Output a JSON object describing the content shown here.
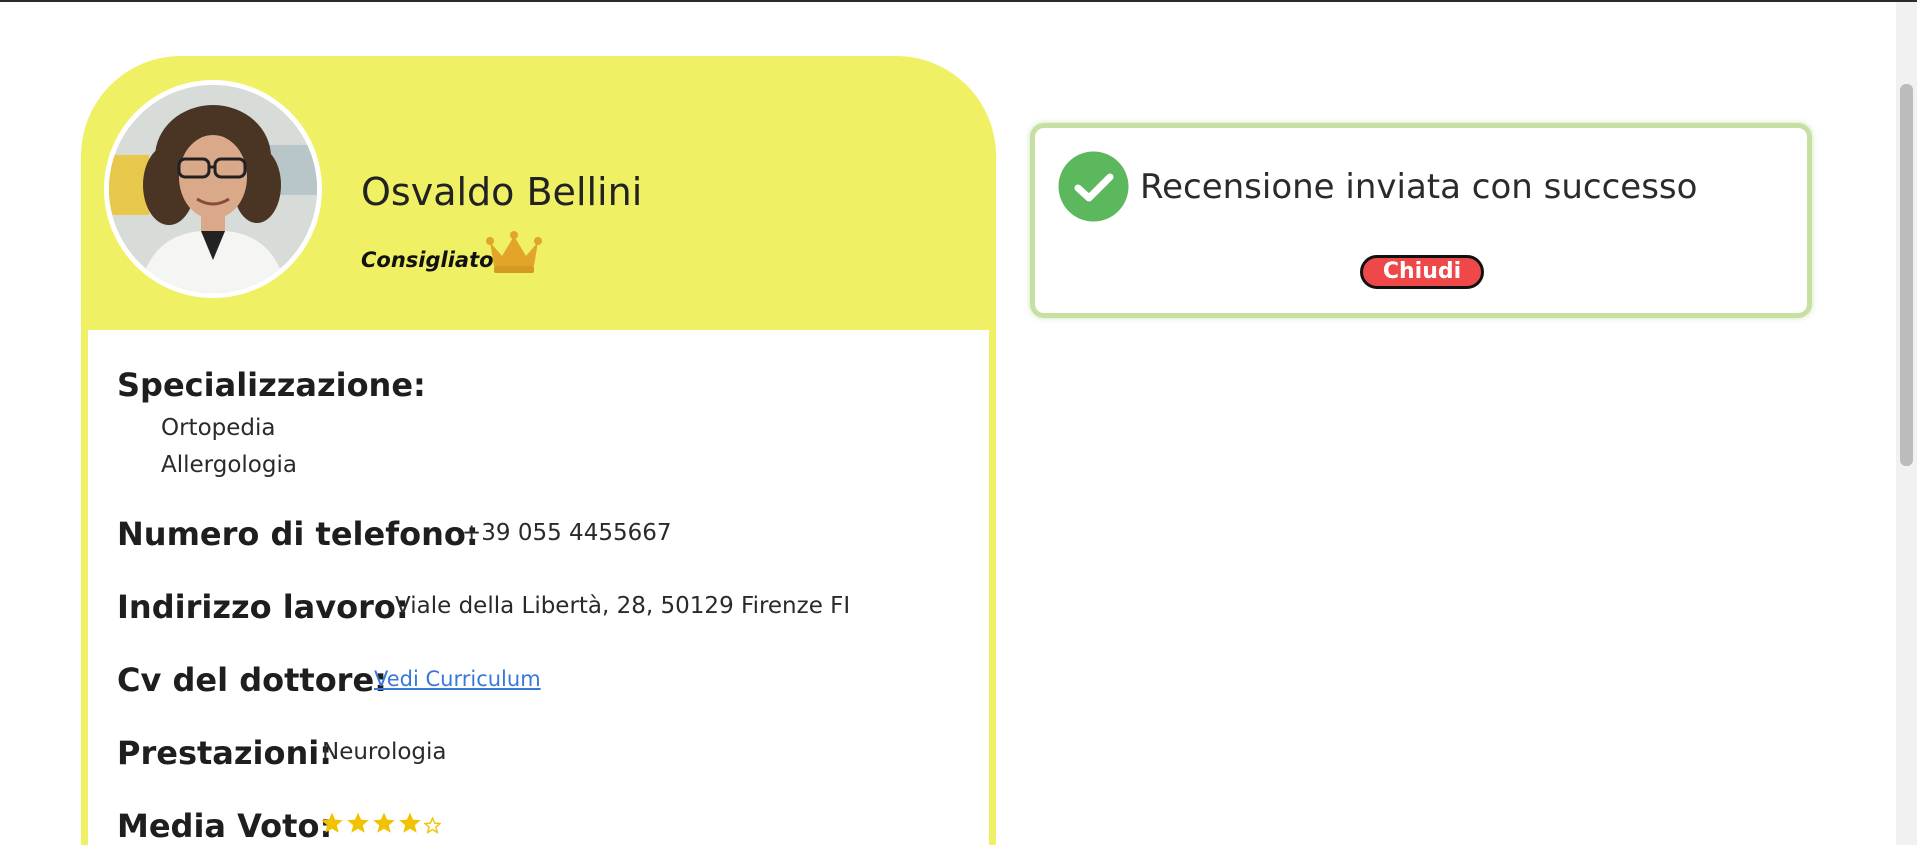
{
  "doctor": {
    "name": "Osvaldo Bellini",
    "badge": "Consigliato",
    "photo_alt": "doctor-photo"
  },
  "fields": {
    "specialization_label": "Specializzazione:",
    "specializations": [
      "Ortopedia",
      "Allergologia"
    ],
    "phone_label": "Numero di telefono:",
    "phone_value": "+39 055 4455667",
    "address_label": "Indirizzo lavoro:",
    "address_value": "Viale della Libertà, 28, 50129 Firenze FI",
    "cv_label": "Cv del dottore:",
    "cv_link": "Vedi Curriculum",
    "services_label": "Prestazioni:",
    "services_value": "Neurologia",
    "rating_label": "Media Voto:",
    "rating_value": 4,
    "rating_max": 5
  },
  "toast": {
    "message": "Recensione inviata con successo",
    "close_label": "Chiudi"
  },
  "colors": {
    "card_yellow": "#f0f064",
    "toast_border": "#c6e0a4",
    "success_green": "#5cb85c",
    "close_red": "#ef4848",
    "link_blue": "#3a78d8",
    "star_gold": "#f2c200",
    "crown_gold": "#e2a52a"
  },
  "icons": {
    "crown": "crown-icon",
    "check": "check-circle-icon",
    "star": "star-icon"
  }
}
